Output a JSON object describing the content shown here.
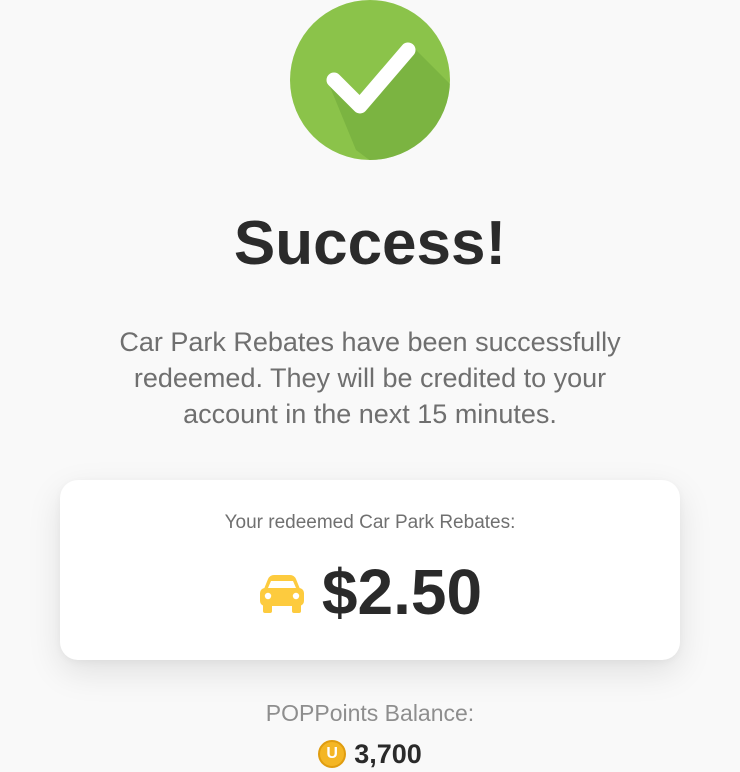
{
  "success": {
    "icon": "check-circle-icon",
    "title": "Success!",
    "message": "Car Park Rebates have been successfully redeemed. They will be credited to your account in the next 15 minutes."
  },
  "rebate_card": {
    "label": "Your redeemed Car Park Rebates:",
    "icon": "car-icon",
    "amount": "$2.50"
  },
  "balance": {
    "label": "POPPoints Balance:",
    "icon": "coin-icon",
    "coin_letter": "U",
    "value": "3,700"
  },
  "colors": {
    "success_green": "#8bc34a",
    "car_yellow": "#fdcb3e",
    "coin_gold": "#f4b625"
  }
}
